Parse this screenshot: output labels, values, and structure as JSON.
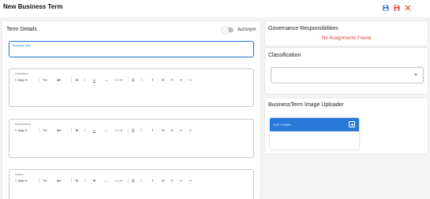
{
  "header": {
    "title": "New Business Term",
    "actions": [
      {
        "name": "save-icon",
        "color": "#1976d2"
      },
      {
        "name": "save-close-icon",
        "color": "#e53935"
      },
      {
        "name": "close-icon",
        "color": "#e53935"
      }
    ]
  },
  "term_details": {
    "title": "Term Details",
    "acronym_label": "Acronym",
    "acronym_on": false,
    "business_term": {
      "label": "Business Term",
      "value": ""
    },
    "editors": [
      {
        "label": "Definition",
        "value": ""
      },
      {
        "label": "Description",
        "value": ""
      },
      {
        "label": "Notes",
        "value": ""
      }
    ],
    "toolbar": {
      "align_label": "Align",
      "bold_label": "B",
      "italic_label": "I",
      "underline_label": "U",
      "strike_label": "S",
      "hr_label": "—",
      "link_label": "⊂⊃"
    }
  },
  "governance": {
    "title": "Governance Responsibilities",
    "empty_text": "No Assignments Found"
  },
  "classification": {
    "title": "Classification",
    "selected": ""
  },
  "uploader": {
    "title": "BusinessTerm Image Uploader",
    "progress_text": "0.00 / 0.00%",
    "progress": 0
  },
  "colors": {
    "accent": "#1976d2",
    "danger": "#e53935",
    "uploader_bar": "#2979d9"
  }
}
